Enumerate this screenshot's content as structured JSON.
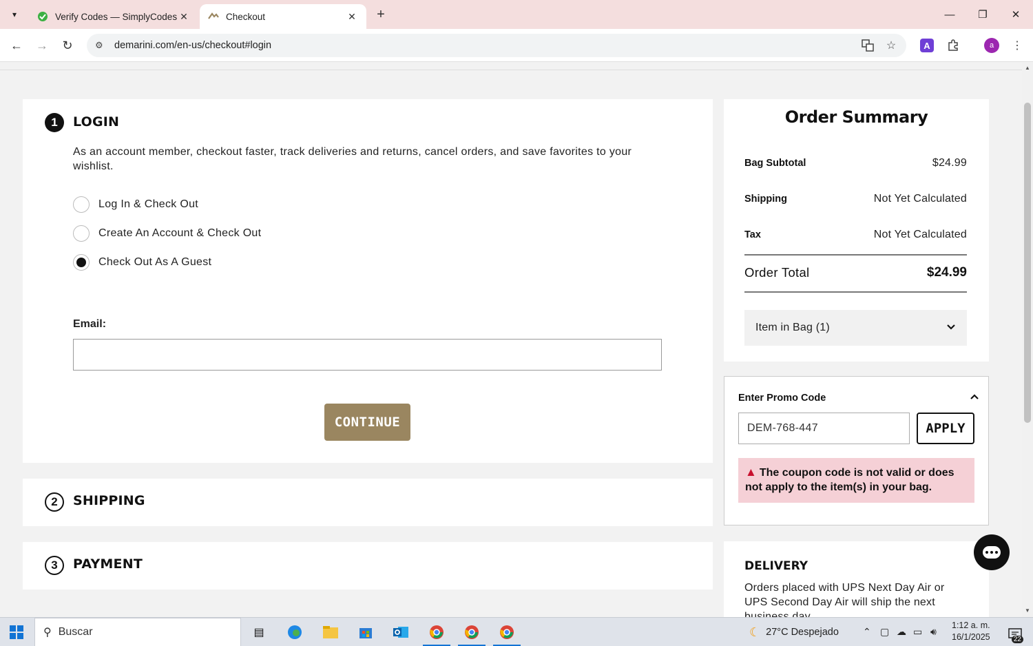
{
  "browser": {
    "tabs": [
      {
        "title": "Verify Codes — SimplyCodes",
        "active": false,
        "favicon": "simplycodes-leaf-icon"
      },
      {
        "title": "Checkout",
        "active": true,
        "favicon": "demarini-logo-icon"
      }
    ],
    "url": "demarini.com/en-us/checkout#login",
    "profile_initial": "a",
    "extension_letter": "A"
  },
  "checkout": {
    "login": {
      "step": "1",
      "title": "LOGIN",
      "description": "As an account member, checkout faster, track deliveries and returns, cancel orders, and save favorites to your wishlist.",
      "options": [
        {
          "label": "Log In & Check Out",
          "selected": false
        },
        {
          "label": "Create An Account & Check Out",
          "selected": false
        },
        {
          "label": "Check Out As A Guest",
          "selected": true
        }
      ],
      "email_label": "Email:",
      "email_value": "",
      "continue_label": "CONTINUE"
    },
    "shipping": {
      "step": "2",
      "title": "SHIPPING"
    },
    "payment": {
      "step": "3",
      "title": "PAYMENT"
    }
  },
  "summary": {
    "title": "Order Summary",
    "rows": [
      {
        "label": "Bag Subtotal",
        "value": "$24.99"
      },
      {
        "label": "Shipping",
        "value": "Not Yet Calculated"
      },
      {
        "label": "Tax",
        "value": "Not Yet Calculated"
      }
    ],
    "total_label": "Order Total",
    "total_value": "$24.99",
    "bag_toggle_label": "Item in Bag (1)"
  },
  "promo": {
    "label": "Enter Promo Code",
    "code_value": "DEM-768-447",
    "apply_label": "APPLY",
    "error_text": "The coupon code is not valid or does not apply to the item(s) in your bag."
  },
  "delivery": {
    "title": "DELIVERY",
    "text": "Orders placed with UPS Next Day Air or UPS Second Day Air will ship the next business day."
  },
  "taskbar": {
    "search_placeholder": "Buscar",
    "weather": "27°C  Despejado",
    "time": "1:12 a. m.",
    "date": "16/1/2025",
    "notification_count": "22"
  },
  "colors": {
    "accent_button": "#9a8660",
    "error_bg": "#f5d0d6",
    "error_icon": "#c8102e",
    "tabstrip_bg": "#f4dede"
  }
}
